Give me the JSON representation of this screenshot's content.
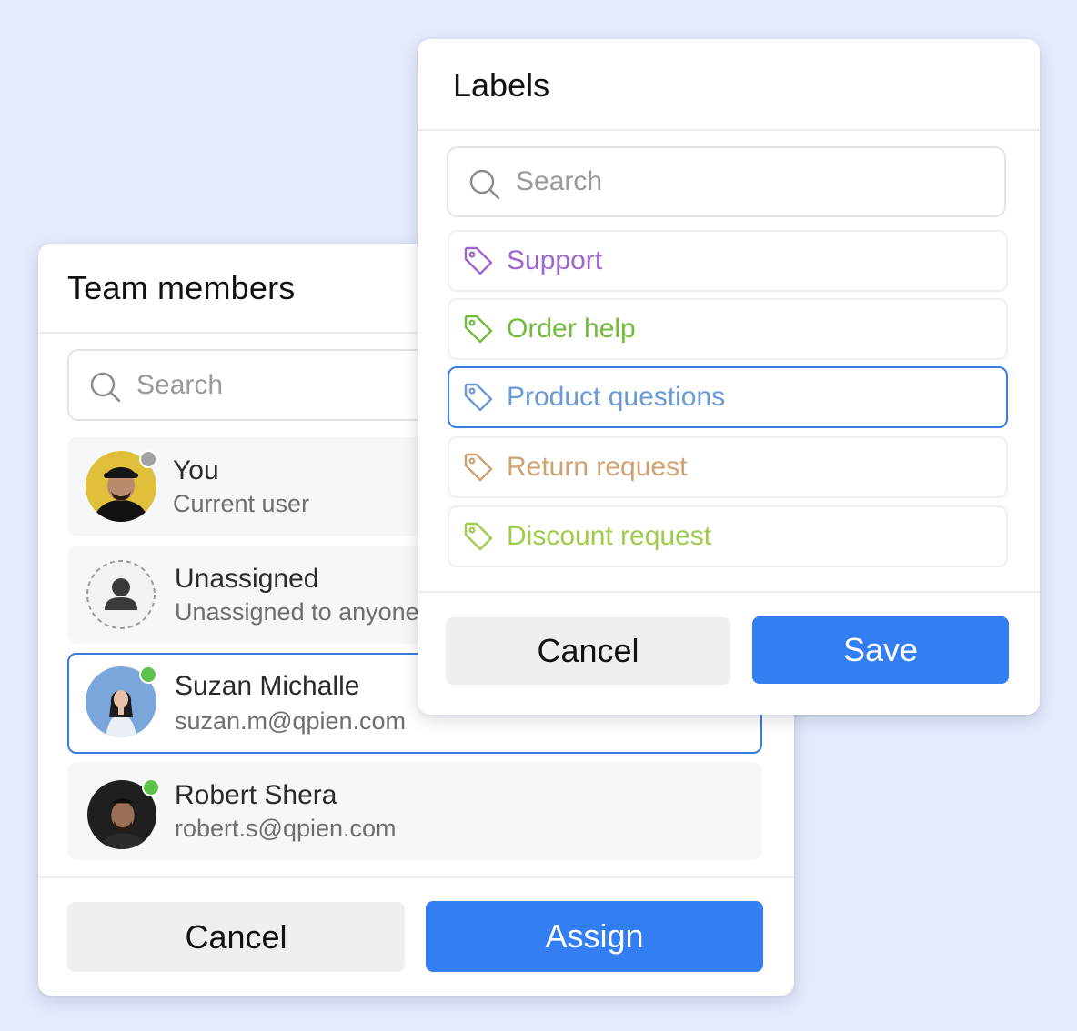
{
  "team_panel": {
    "title": "Team members",
    "search_placeholder": "Search",
    "members": [
      {
        "name": "You",
        "sub": "Current user",
        "status_color": "#a3a3a3",
        "selected": false
      },
      {
        "name": "Unassigned",
        "sub": "Unassigned to anyone",
        "status_color": null,
        "selected": false
      },
      {
        "name": "Suzan Michalle",
        "sub": "suzan.m@qpien.com",
        "status_color": "#5cc24a",
        "selected": true
      },
      {
        "name": "Robert Shera",
        "sub": "robert.s@qpien.com",
        "status_color": "#5cc24a",
        "selected": false
      }
    ],
    "cancel_label": "Cancel",
    "assign_label": "Assign"
  },
  "labels_panel": {
    "title": "Labels",
    "search_placeholder": "Search",
    "labels": [
      {
        "text": "Support",
        "color": "#a066d0",
        "selected": false
      },
      {
        "text": "Order help",
        "color": "#6fbd38",
        "selected": false
      },
      {
        "text": "Product questions",
        "color": "#6a9ad6",
        "selected": true
      },
      {
        "text": "Return request",
        "color": "#cfa272",
        "selected": false
      },
      {
        "text": "Discount request",
        "color": "#9ccc4a",
        "selected": false
      }
    ],
    "cancel_label": "Cancel",
    "save_label": "Save"
  },
  "colors": {
    "background": "#e5eafc",
    "primary_button": "#327ef2",
    "selected_border": "#3a7be0",
    "online": "#5cc24a",
    "offline": "#a3a3a3"
  },
  "icons": [
    "search-icon",
    "tag-icon",
    "person-icon"
  ]
}
